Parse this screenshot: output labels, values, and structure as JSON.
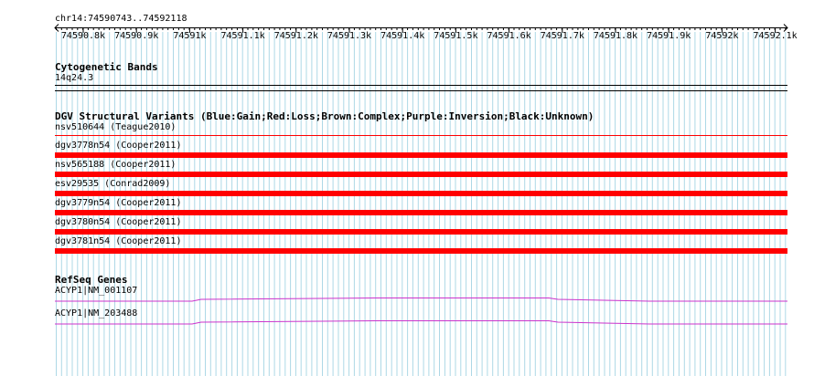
{
  "ruler": {
    "region": "chr14:74590743..74592118",
    "ticks": [
      "74590.8k",
      "74590.9k",
      "74591k",
      "74591.1k",
      "74591.2k",
      "74591.3k",
      "74591.4k",
      "74591.5k",
      "74591.6k",
      "74591.7k",
      "74591.8k",
      "74591.9k",
      "74592k",
      "74592.1k"
    ]
  },
  "cytobands": {
    "title": "Cytogenetic Bands",
    "band": "14q24.3"
  },
  "dgv": {
    "title": "DGV Structural Variants (Blue:Gain;Red:Loss;Brown:Complex;Purple:Inversion;Black:Unknown)",
    "items": [
      {
        "label": "nsv510644 (Teague2010)",
        "type": "Loss",
        "color": "#ff0000",
        "style": "thin"
      },
      {
        "label": "dgv3778n54 (Cooper2011)",
        "type": "Loss",
        "color": "#ff0000",
        "style": "thick"
      },
      {
        "label": "nsv565188 (Cooper2011)",
        "type": "Loss",
        "color": "#ff0000",
        "style": "thick"
      },
      {
        "label": "esv29535 (Conrad2009)",
        "type": "Loss",
        "color": "#ff0000",
        "style": "thick"
      },
      {
        "label": "dgv3779n54 (Cooper2011)",
        "type": "Loss",
        "color": "#ff0000",
        "style": "thick"
      },
      {
        "label": "dgv3780n54 (Cooper2011)",
        "type": "Loss",
        "color": "#ff0000",
        "style": "thick"
      },
      {
        "label": "dgv3781n54 (Cooper2011)",
        "type": "Loss",
        "color": "#ff0000",
        "style": "thick"
      }
    ]
  },
  "refseq": {
    "title": "RefSeq Genes",
    "genes": [
      {
        "label": "ACYP1|NM_001107",
        "color": "#cc33cc"
      },
      {
        "label": "ACYP1|NM_203488",
        "color": "#cc33cc"
      }
    ]
  },
  "colors": {
    "grid": "#add8e6",
    "loss": "#ff0000",
    "gene": "#cc33cc"
  }
}
